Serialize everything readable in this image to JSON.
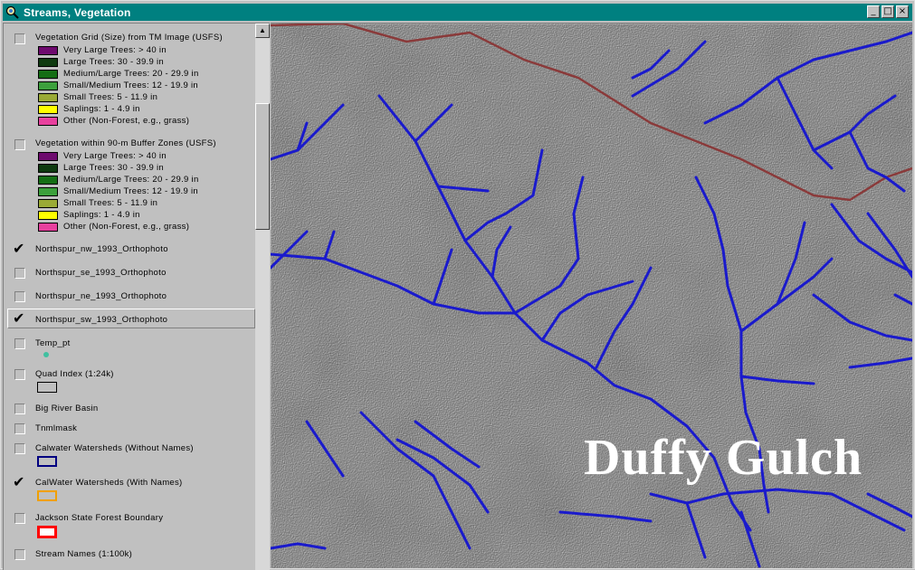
{
  "window": {
    "title": "Streams, Vegetation",
    "buttons": [
      "_",
      "□",
      "×"
    ]
  },
  "toc": {
    "layers": [
      {
        "id": "veg_grid",
        "label": "Vegetation Grid (Size) from TM Image (USFS)",
        "checked": false,
        "legend": [
          {
            "label": "Very Large Trees: > 40  in",
            "color": "#6e0a6e"
          },
          {
            "label": "Large Trees: 30 - 39.9 in",
            "color": "#0f3a10"
          },
          {
            "label": "Medium/Large Trees: 20 - 29.9 in",
            "color": "#146e14"
          },
          {
            "label": "Small/Medium Trees: 12 - 19.9 in",
            "color": "#3ca03c"
          },
          {
            "label": "Small Trees: 5 - 11.9 in",
            "color": "#9aaa36"
          },
          {
            "label": "Saplings: 1 - 4.9 in",
            "color": "#ffff00"
          },
          {
            "label": "Other (Non-Forest, e.g., grass)",
            "color": "#e8409e"
          }
        ]
      },
      {
        "id": "veg_buffer",
        "label": "Vegetation within 90-m Buffer Zones (USFS)",
        "checked": false,
        "legend": [
          {
            "label": "Very Large Trees: > 40  in",
            "color": "#6e0a6e"
          },
          {
            "label": "Large Trees: 30 - 39.9 in",
            "color": "#0f3a10"
          },
          {
            "label": "Medium/Large Trees: 20 - 29.9 in",
            "color": "#146e14"
          },
          {
            "label": "Small/Medium Trees: 12 - 19.9 in",
            "color": "#3ca03c"
          },
          {
            "label": "Small Trees: 5 - 11.9 in",
            "color": "#9aaa36"
          },
          {
            "label": "Saplings: 1 - 4.9 in",
            "color": "#ffff00"
          },
          {
            "label": "Other (Non-Forest, e.g., grass)",
            "color": "#e8409e"
          }
        ]
      },
      {
        "id": "nw",
        "label": "Northspur_nw_1993_Orthophoto",
        "checked": true
      },
      {
        "id": "se",
        "label": "Northspur_se_1993_Orthophoto",
        "checked": false
      },
      {
        "id": "ne",
        "label": "Northspur_ne_1993_Orthophoto",
        "checked": false
      },
      {
        "id": "sw",
        "label": "Northspur_sw_1993_Orthophoto",
        "checked": true,
        "active": true
      },
      {
        "id": "temp",
        "label": "Temp_pt",
        "checked": false,
        "symbol": "point",
        "color": "#40c0a0"
      },
      {
        "id": "quad",
        "label": "Quad Index (1:24k)",
        "checked": false,
        "symbol": "box",
        "fill": "#c0c0c0",
        "border": "#000000"
      },
      {
        "id": "bigriver",
        "label": "Big River Basin",
        "checked": false
      },
      {
        "id": "tnml",
        "label": "Tnmlmask",
        "checked": false
      },
      {
        "id": "calw_nonames",
        "label": "Calwater Watersheds (Without Names)",
        "checked": false,
        "symbol": "box",
        "fill": "#c0c0c0",
        "border": "#000080"
      },
      {
        "id": "calw_names",
        "label": "CalWater Watersheds (With Names)",
        "checked": true,
        "symbol": "box",
        "fill": "#c0c0c0",
        "border": "#f0a000"
      },
      {
        "id": "jackson",
        "label": "Jackson State Forest Boundary",
        "checked": false,
        "symbol": "box",
        "fill": "#ffffff",
        "border": "#ff0000"
      },
      {
        "id": "streamnames",
        "label": "Stream Names (1:100k)",
        "checked": false
      }
    ]
  },
  "map": {
    "label": "Duffy Gulch",
    "stream_color": "#1a1acc",
    "boundary_color": "#8a3a3a"
  }
}
